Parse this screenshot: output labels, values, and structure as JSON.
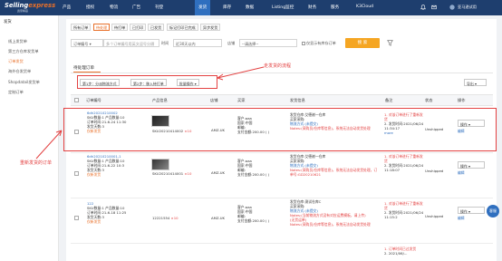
{
  "brand": {
    "name_a": "Selling",
    "name_b": "express",
    "tagline": "賣家精靈"
  },
  "nav": [
    "产品",
    "授权",
    "物流",
    "广告",
    "刊登",
    "发货",
    "库存",
    "数据",
    "Listing监控",
    "财务",
    "服务",
    "K3Cloud"
  ],
  "nav_active_index": 5,
  "top_right": {
    "user": "亚马逊试用"
  },
  "sidebar": {
    "group": "发货",
    "items": [
      "线上发货单",
      "第三方仓库发货单",
      "订单发货",
      "海外仓发货单",
      "Shopdatail发货单",
      "定制订单"
    ],
    "active_index": 2
  },
  "tabs": [
    "所有订单",
    "待处理",
    "待打单",
    "已打印",
    "已发货",
    "标记打印已完成",
    "异步发货",
    "订单"
  ],
  "tabs_active_index": 1,
  "filters": {
    "order_type": "订单编号",
    "order_input_placeholder": "多个订单编号用英文逗号分隔",
    "time_label": "时间",
    "time_value": "近30天以内",
    "shop_label": "店铺",
    "shop_value": "--请选择--",
    "checkbox_label": "仅显示有库存订单",
    "search_button": "搜 索"
  },
  "section_title": "待处理订单",
  "toolbar": {
    "btn1": "第1步：分派物流方式",
    "btn2": "第2步：移入待打单",
    "btn3": "批量操作",
    "export": "导出"
  },
  "annotations": {
    "flow": "走发货的流程",
    "resend": "重新发货的订单"
  },
  "columns": [
    "订单编号",
    "产品信息",
    "店铺",
    "买家",
    "发货信息",
    "备注",
    "状态",
    "操作"
  ],
  "rows": [
    {
      "order_no": "6dh20210210002",
      "info_lines": [
        "SKU数量:1  产品数量:10",
        "订单时间:21-6-24 11:30",
        "发货天数:3"
      ],
      "badge": "仅新发货",
      "product_code": "SKU20210414002",
      "qty": "×10",
      "shop": "AMZ-UK",
      "buyer": [
        "客户:aaa",
        "国家:中国",
        "邮编:",
        "支付金额:200.00 ( )"
      ],
      "ship": [
        "发货仓库:艾德谢一仓库",
        "买家采购:",
        "物流方式:(未提交)",
        "Notes:(采购员/仓库等信息)，系统无法自动发货处理"
      ],
      "remark": [
        "1. 对该订单进行了重新发货",
        "2. 发货时间:2021/06/24 11:34:17",
        "more"
      ],
      "status": "Unshipped",
      "op": "操作",
      "op2": "编辑"
    },
    {
      "order_no": "6dh20210210001-1",
      "info_lines": [
        "SKU数量:1  产品数量:10",
        "订单时间:21-6-22 10:3",
        "发货天数:3"
      ],
      "badge": "仅新发货",
      "product_code": "SKU20210414001",
      "qty": "×10",
      "shop": "AMZ-UK",
      "buyer": [
        "客户:aaa",
        "国家:中国",
        "邮编:",
        "支付金额:200.00 ( )"
      ],
      "ship": [
        "发货仓库:艾德谢一仓库",
        "买家采购:",
        "物流方式:(未提交)",
        "Notes:(采购员/仓库等信息)，系统无法自动发货处理，订单号:GD20210621"
      ],
      "remark": [
        "1. 对该订单进行了重新发货",
        "2. 发货时间:2021/06/24 11:18:07"
      ],
      "status": "Unshipped",
      "op": "操作",
      "op2": "编辑"
    },
    {
      "order_no": "122",
      "info_lines": [
        "SKU数量:1  产品数量:10",
        "订单时间:21-6-18 11:25",
        "发货天数:3"
      ],
      "badge": "仅新发货",
      "product_code": "12221554",
      "qty": "×10",
      "shop": "AMZ-UK",
      "buyer": [
        "客户:aaa",
        "国家:中国",
        "邮编:",
        "支付金额:200.00 ( )"
      ],
      "ship": [
        "发货仓库:测试仓库C",
        "买家采购:",
        "物流方式:(未提交)",
        "Notes:(当前物流方式没有对应运费模板，请上传)",
        "(无货运单)",
        "Notes:(采购员/仓库等信息)，系统无法自动发货处理"
      ],
      "remark": [
        "1. 对该订单进行了重新发货",
        "2. 发货时间:2021/06/24 11:15:2"
      ],
      "status": "Unshipped",
      "op": "操作",
      "op2": "编辑"
    },
    {
      "order_no": "",
      "remark": [
        "1. 订单时间已过发货",
        "2. 2021/06/..."
      ]
    }
  ],
  "float_button": "客服",
  "colors": {
    "topbar": "#1e3e6e",
    "accent": "#e8702a",
    "highlight": "#e34141",
    "link": "#2f6fbf"
  }
}
